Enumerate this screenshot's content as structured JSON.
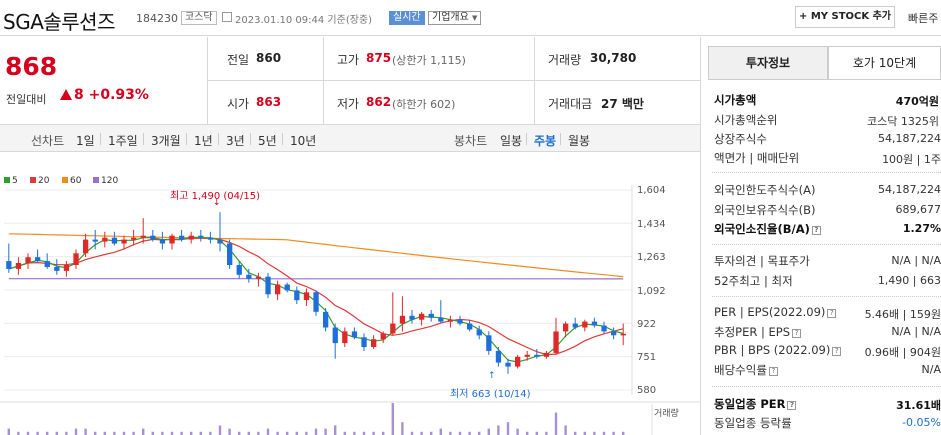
{
  "header": {
    "company_name": "SGA솔루션즈",
    "code": "184230",
    "market_tag": "코스닥",
    "datetime": "2023.01.10 09:44 기준(장중)",
    "realtime_tag": "실시간",
    "overview_dropdown": "기업개요",
    "my_stock_button": "MY STOCK 추가",
    "fast_link": "빠른주"
  },
  "price": {
    "current": "868",
    "change_label": "전일대비",
    "change_amount": "8",
    "change_pct": "+0.93%"
  },
  "quote": {
    "prev_label": "전일",
    "prev_value": "860",
    "high_label": "고가",
    "high_value": "875",
    "upper_limit": "(상한가 1,115)",
    "volume_label": "거래량",
    "volume_value": "30,780",
    "open_label": "시가",
    "open_value": "863",
    "low_label": "저가",
    "low_value": "862",
    "lower_limit": "(하한가 602)",
    "amount_label": "거래대금",
    "amount_value": "27 백만"
  },
  "chart_tabs": {
    "line_label": "선차트",
    "line_periods": [
      "1일",
      "1주일",
      "3개월",
      "1년",
      "3년",
      "5년",
      "10년"
    ],
    "candle_label": "봉차트",
    "candle_periods": [
      "일봉",
      "주봉",
      "월봉"
    ],
    "selected_candle": "주봉"
  },
  "chart_data": {
    "type": "candlestick",
    "legend": [
      "5",
      "20",
      "60",
      "120"
    ],
    "ma_colors": {
      "5": "#2e9e2e",
      "20": "#e03a3a",
      "60": "#f08c1e",
      "120": "#9a6fd1"
    },
    "up_color": "#e02828",
    "down_color": "#1e6fd9",
    "y_ticks": [
      "1,604",
      "1,434",
      "1,263",
      "1,092",
      "922",
      "751",
      "580"
    ],
    "ylim": [
      580,
      1604
    ],
    "high_annotation": "최고 1,490 (04/15)",
    "low_annotation": "최저 663 (10/14)",
    "volume_label": "거래량",
    "candles": [
      {
        "o": 1240,
        "h": 1330,
        "l": 1180,
        "c": 1200
      },
      {
        "o": 1200,
        "h": 1260,
        "l": 1170,
        "c": 1230
      },
      {
        "o": 1230,
        "h": 1280,
        "l": 1200,
        "c": 1260
      },
      {
        "o": 1260,
        "h": 1300,
        "l": 1230,
        "c": 1240
      },
      {
        "o": 1240,
        "h": 1280,
        "l": 1200,
        "c": 1210
      },
      {
        "o": 1210,
        "h": 1250,
        "l": 1170,
        "c": 1190
      },
      {
        "o": 1190,
        "h": 1240,
        "l": 1160,
        "c": 1220
      },
      {
        "o": 1220,
        "h": 1300,
        "l": 1200,
        "c": 1280
      },
      {
        "o": 1280,
        "h": 1380,
        "l": 1260,
        "c": 1350
      },
      {
        "o": 1350,
        "h": 1400,
        "l": 1300,
        "c": 1340
      },
      {
        "o": 1340,
        "h": 1390,
        "l": 1310,
        "c": 1360
      },
      {
        "o": 1360,
        "h": 1390,
        "l": 1320,
        "c": 1330
      },
      {
        "o": 1330,
        "h": 1370,
        "l": 1300,
        "c": 1350
      },
      {
        "o": 1350,
        "h": 1400,
        "l": 1320,
        "c": 1360
      },
      {
        "o": 1360,
        "h": 1460,
        "l": 1330,
        "c": 1370
      },
      {
        "o": 1370,
        "h": 1400,
        "l": 1340,
        "c": 1350
      },
      {
        "o": 1350,
        "h": 1390,
        "l": 1300,
        "c": 1330
      },
      {
        "o": 1330,
        "h": 1380,
        "l": 1300,
        "c": 1370
      },
      {
        "o": 1370,
        "h": 1400,
        "l": 1340,
        "c": 1350
      },
      {
        "o": 1350,
        "h": 1390,
        "l": 1330,
        "c": 1370
      },
      {
        "o": 1370,
        "h": 1400,
        "l": 1340,
        "c": 1360
      },
      {
        "o": 1360,
        "h": 1390,
        "l": 1330,
        "c": 1350
      },
      {
        "o": 1350,
        "h": 1490,
        "l": 1290,
        "c": 1330
      },
      {
        "o": 1330,
        "h": 1350,
        "l": 1200,
        "c": 1220
      },
      {
        "o": 1220,
        "h": 1240,
        "l": 1150,
        "c": 1170
      },
      {
        "o": 1170,
        "h": 1200,
        "l": 1130,
        "c": 1150
      },
      {
        "o": 1150,
        "h": 1180,
        "l": 1110,
        "c": 1160
      },
      {
        "o": 1160,
        "h": 1180,
        "l": 1050,
        "c": 1070
      },
      {
        "o": 1070,
        "h": 1140,
        "l": 1040,
        "c": 1120
      },
      {
        "o": 1120,
        "h": 1130,
        "l": 1080,
        "c": 1090
      },
      {
        "o": 1090,
        "h": 1110,
        "l": 1020,
        "c": 1040
      },
      {
        "o": 1040,
        "h": 1100,
        "l": 1010,
        "c": 1080
      },
      {
        "o": 1080,
        "h": 1090,
        "l": 960,
        "c": 980
      },
      {
        "o": 980,
        "h": 1000,
        "l": 880,
        "c": 900
      },
      {
        "o": 900,
        "h": 920,
        "l": 740,
        "c": 820
      },
      {
        "o": 820,
        "h": 900,
        "l": 800,
        "c": 880
      },
      {
        "o": 880,
        "h": 900,
        "l": 840,
        "c": 850
      },
      {
        "o": 850,
        "h": 870,
        "l": 780,
        "c": 800
      },
      {
        "o": 800,
        "h": 860,
        "l": 790,
        "c": 840
      },
      {
        "o": 840,
        "h": 880,
        "l": 820,
        "c": 870
      },
      {
        "o": 870,
        "h": 1080,
        "l": 860,
        "c": 920
      },
      {
        "o": 920,
        "h": 1060,
        "l": 880,
        "c": 960
      },
      {
        "o": 960,
        "h": 990,
        "l": 920,
        "c": 940
      },
      {
        "o": 940,
        "h": 980,
        "l": 910,
        "c": 970
      },
      {
        "o": 970,
        "h": 990,
        "l": 930,
        "c": 950
      },
      {
        "o": 950,
        "h": 1040,
        "l": 920,
        "c": 930
      },
      {
        "o": 930,
        "h": 960,
        "l": 900,
        "c": 940
      },
      {
        "o": 940,
        "h": 960,
        "l": 910,
        "c": 920
      },
      {
        "o": 920,
        "h": 940,
        "l": 880,
        "c": 890
      },
      {
        "o": 890,
        "h": 910,
        "l": 840,
        "c": 860
      },
      {
        "o": 860,
        "h": 880,
        "l": 760,
        "c": 780
      },
      {
        "o": 780,
        "h": 800,
        "l": 700,
        "c": 720
      },
      {
        "o": 720,
        "h": 740,
        "l": 663,
        "c": 700
      },
      {
        "o": 700,
        "h": 760,
        "l": 690,
        "c": 750
      },
      {
        "o": 750,
        "h": 780,
        "l": 730,
        "c": 760
      },
      {
        "o": 760,
        "h": 790,
        "l": 740,
        "c": 750
      },
      {
        "o": 750,
        "h": 780,
        "l": 740,
        "c": 770
      },
      {
        "o": 770,
        "h": 950,
        "l": 760,
        "c": 880
      },
      {
        "o": 880,
        "h": 930,
        "l": 850,
        "c": 920
      },
      {
        "o": 920,
        "h": 950,
        "l": 890,
        "c": 900
      },
      {
        "o": 900,
        "h": 940,
        "l": 880,
        "c": 930
      },
      {
        "o": 930,
        "h": 950,
        "l": 900,
        "c": 910
      },
      {
        "o": 910,
        "h": 930,
        "l": 870,
        "c": 880
      },
      {
        "o": 880,
        "h": 900,
        "l": 840,
        "c": 860
      },
      {
        "o": 860,
        "h": 920,
        "l": 810,
        "c": 868
      }
    ],
    "volumes": [
      2,
      1,
      1,
      1,
      1,
      1,
      1,
      2,
      2,
      1,
      1,
      1,
      1,
      1,
      2,
      1,
      1,
      1,
      1,
      1,
      1,
      1,
      3,
      2,
      1,
      1,
      1,
      2,
      1,
      1,
      1,
      1,
      2,
      2,
      3,
      1,
      1,
      1,
      1,
      1,
      10,
      4,
      1,
      1,
      1,
      2,
      1,
      1,
      1,
      1,
      2,
      3,
      4,
      2,
      1,
      1,
      1,
      7,
      3,
      1,
      1,
      1,
      1,
      1,
      1
    ]
  },
  "invest_tabs": {
    "tab1": "투자정보",
    "tab2": "호가 10단계"
  },
  "invest": {
    "market_cap_label": "시가총액",
    "market_cap_value": "470억원",
    "rank_label": "시가총액순위",
    "rank_value": "코스닥 1325위",
    "shares_label": "상장주식수",
    "shares_value": "54,187,224",
    "par_label": "액면가 | 매매단위",
    "par_value": "100원 | 1주",
    "foreign_limit_label": "외국인한도주식수(A)",
    "foreign_limit_value": "54,187,224",
    "foreign_hold_label": "외국인보유주식수(B)",
    "foreign_hold_value": "689,677",
    "foreign_rate_label": "외국인소진율(B/A)",
    "foreign_rate_value": "1.27%",
    "opinion_label": "투자의견 | 목표주가",
    "opinion_value": "N/A | N/A",
    "week52_label": "52주최고 | 최저",
    "week52_value": "1,490 | 663",
    "per_label": "PER | EPS(2022.09)",
    "per_value": "5.46배 | 159원",
    "est_per_label": "추정PER | EPS",
    "est_per_value": "N/A | N/A",
    "pbr_label": "PBR | BPS (2022.09)",
    "pbr_value": "0.96배 | 904원",
    "div_label": "배당수익률",
    "div_value": "N/A",
    "ind_per_label": "동일업종 PER",
    "ind_per_value": "31.61배",
    "ind_rate_label": "동일업종 등락률",
    "ind_rate_value": "-0.05%"
  }
}
